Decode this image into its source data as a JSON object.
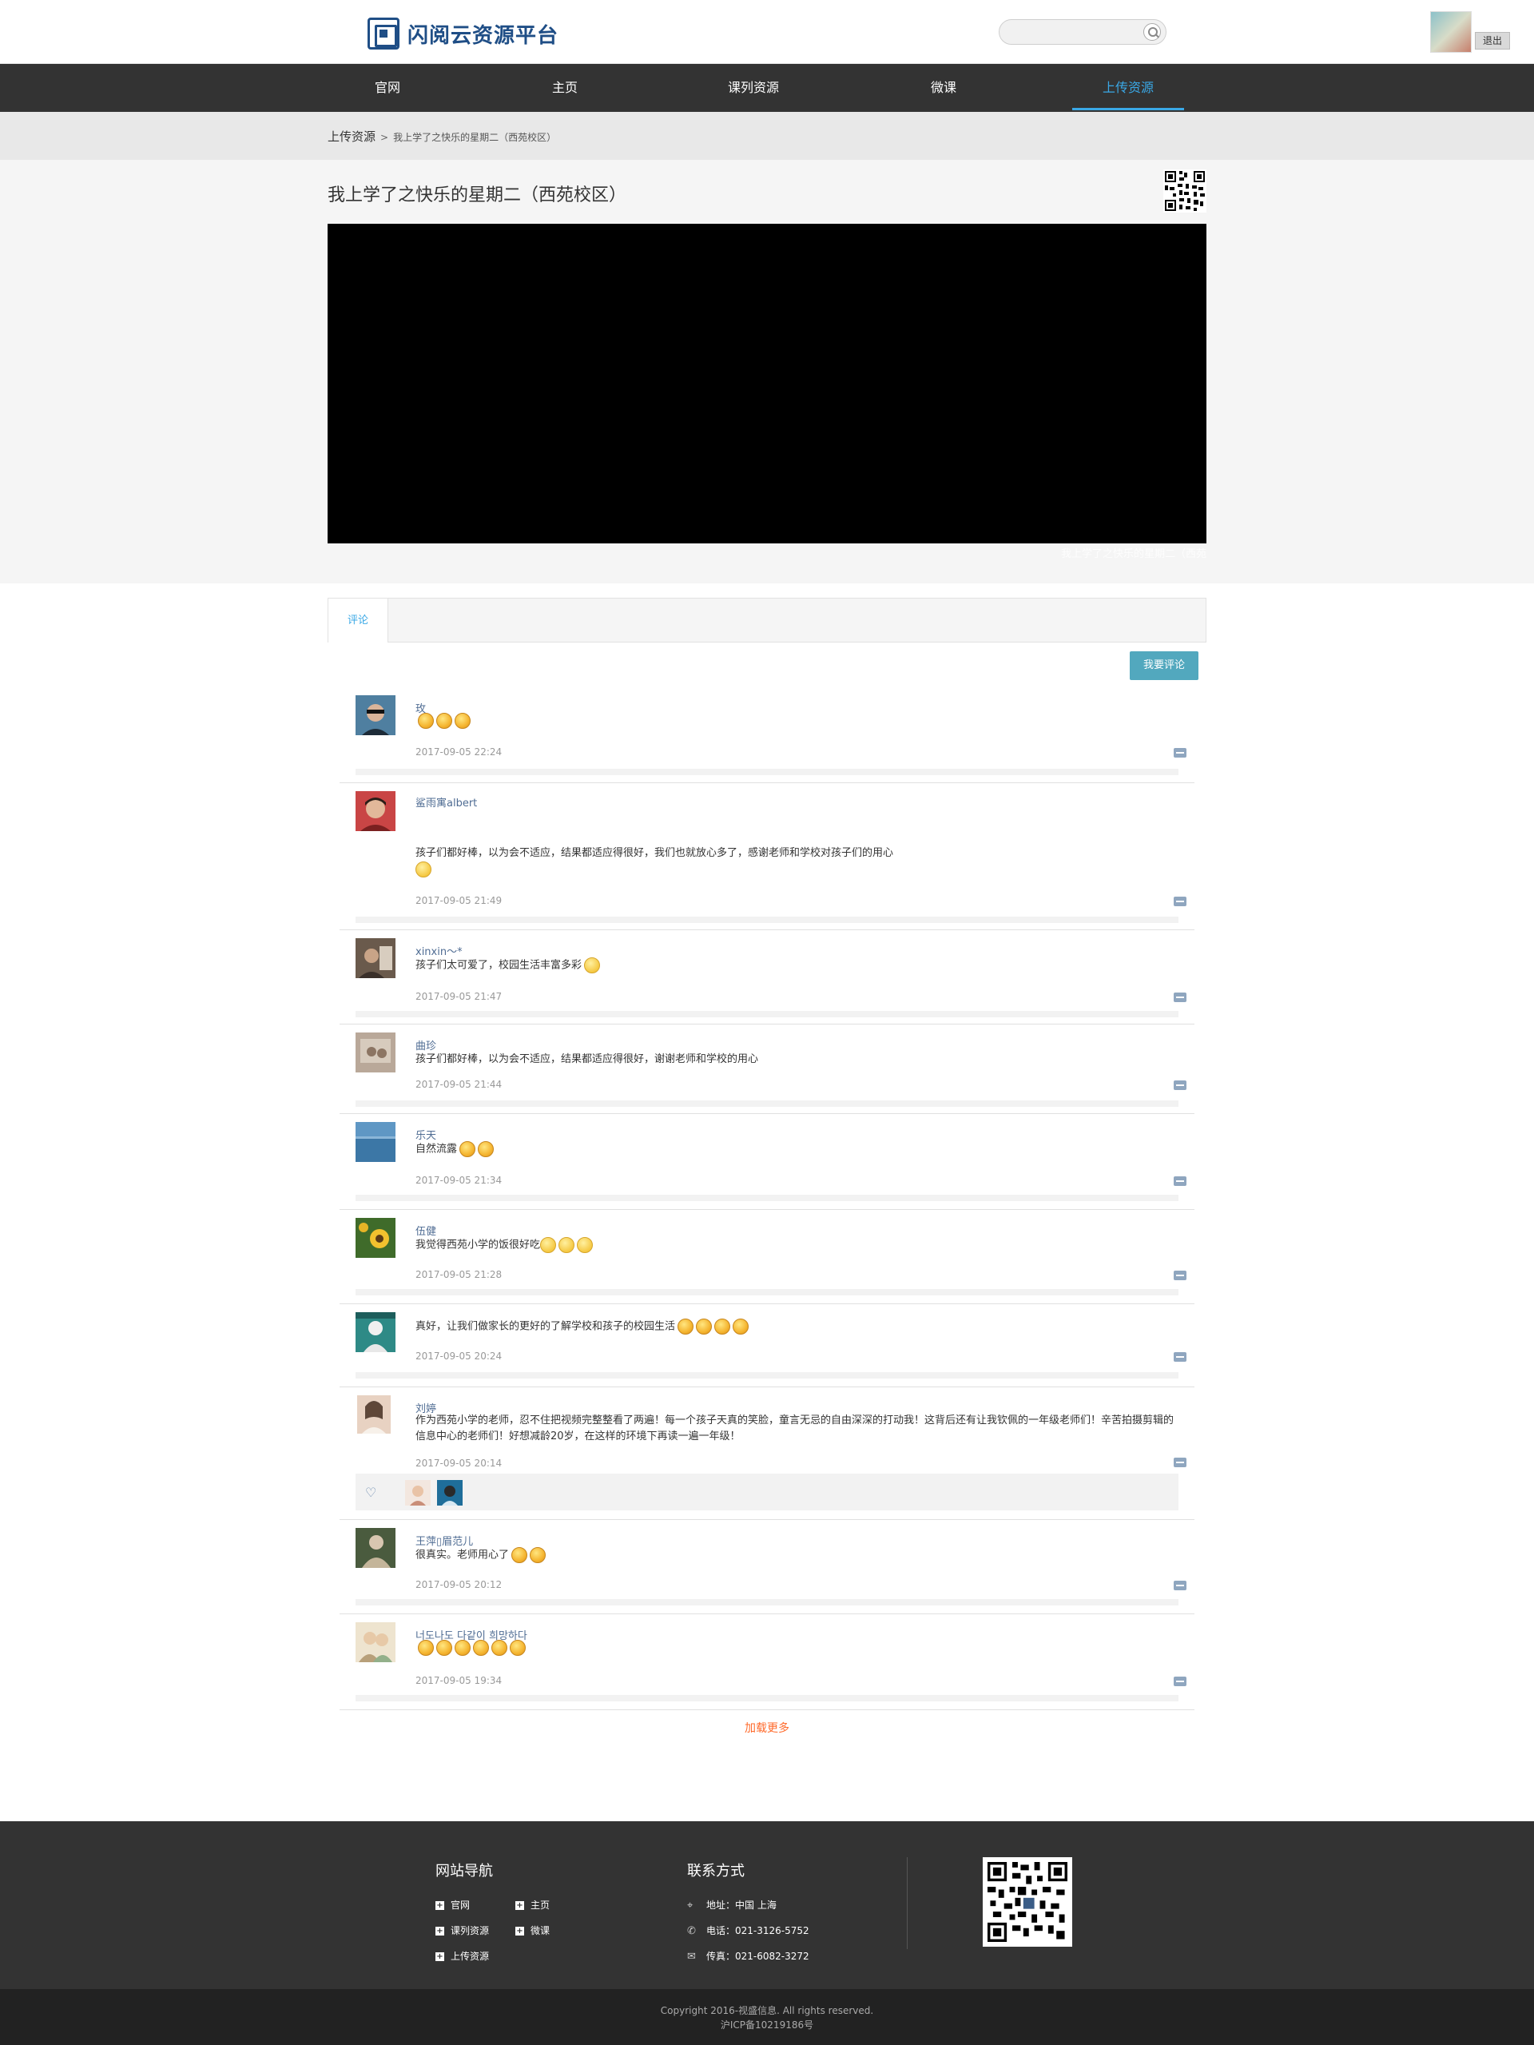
{
  "header": {
    "logo_text": "闪阅云资源平台",
    "search_placeholder": "",
    "logout_label": "退出"
  },
  "nav": {
    "items": [
      {
        "label": "官网"
      },
      {
        "label": "主页"
      },
      {
        "label": "课列资源"
      },
      {
        "label": "微课"
      },
      {
        "label": "上传资源",
        "active": true
      }
    ]
  },
  "breadcrumb": {
    "root": "上传资源",
    "separator": ">",
    "current": "我上学了之快乐的星期二（西苑校区）"
  },
  "video": {
    "title": "我上学了之快乐的星期二（西苑校区）",
    "caption": "我上学了之快乐的星期二（西苑"
  },
  "comments": {
    "tab_label": "评论",
    "add_button": "我要评论",
    "load_more": "加载更多",
    "items": [
      {
        "name": "玫",
        "text": "",
        "thumbs": 3,
        "time": "2017-09-05 22:24"
      },
      {
        "name": "鲨雨寓albert",
        "text": "孩子们都好棒，以为会不适应，结果都适应得很好，我们也就放心多了，感谢老师和学校对孩子们的用心",
        "time": "2017-09-05 21:49"
      },
      {
        "name": "xinxin～*",
        "text": "孩子们太可爱了，校园生活丰富多彩",
        "time": "2017-09-05 21:47"
      },
      {
        "name": "曲珍",
        "text": "孩子们都好棒，以为会不适应，结果都适应得很好，谢谢老师和学校的用心",
        "time": "2017-09-05 21:44"
      },
      {
        "name": "乐天",
        "text": "自然流露",
        "thumbs": 2,
        "time": "2017-09-05 21:34"
      },
      {
        "name": "伍健",
        "text": "我觉得西苑小学的饭很好吃",
        "time": "2017-09-05 21:28"
      },
      {
        "name": "",
        "text": "真好，让我们做家长的更好的了解学校和孩子的校园生活",
        "thumbs": 4,
        "time": "2017-09-05 20:24"
      },
      {
        "name": "刘婷",
        "text": "作为西苑小学的老师，忍不住把视频完整整看了两遍！每一个孩子天真的笑脸，童言无忌的自由深深的打动我！这背后还有让我钦佩的一年级老师们！辛苦拍摄剪辑的信息中心的老师们！好想减龄20岁，在这样的环境下再读一遍一年级！",
        "time": "2017-09-05 20:14"
      },
      {
        "name": "王萍▯眉范儿",
        "text": "很真实。老师用心了",
        "thumbs": 2,
        "time": "2017-09-05 20:12"
      },
      {
        "name": "너도나도 다같이 희망하다",
        "text": "",
        "thumbs": 6,
        "time": "2017-09-05 19:34"
      }
    ]
  },
  "footer": {
    "nav_title": "网站导航",
    "nav_links": [
      "官网",
      "主页",
      "课列资源",
      "微课",
      "上传资源"
    ],
    "contact_title": "联系方式",
    "address": "地址：中国 上海",
    "phone": "电话：021-3126-5752",
    "fax": "传真：021-6082-3272",
    "copyright": "Copyright 2016-视盛信息. All rights reserved.",
    "icp": "沪ICP备10219186号"
  },
  "colors": {
    "nav_bg": "#333333",
    "accent": "#3aa8e6",
    "button": "#52a8be",
    "load_more": "#ff6a2b",
    "brand": "#1f4e86"
  }
}
